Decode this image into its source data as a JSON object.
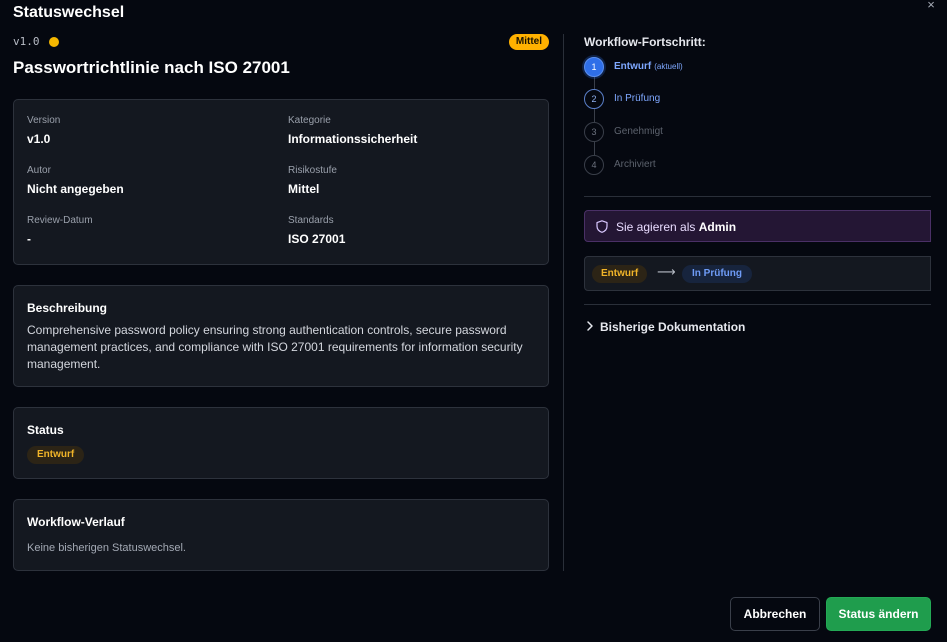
{
  "modal": {
    "title": "Statuswechsel",
    "close_icon": "close-icon",
    "close_glyph": "×"
  },
  "policy": {
    "version_tag": "v1.0",
    "risk_badge": "Mittel",
    "title": "Passwortrichtlinie nach ISO 27001"
  },
  "info": {
    "version_label": "Version",
    "version_value": "v1.0",
    "category_label": "Kategorie",
    "category_value": "Informationssicherheit",
    "author_label": "Autor",
    "author_value": "Nicht angegeben",
    "risk_label": "Risikostufe",
    "risk_value": "Mittel",
    "review_label": "Review-Datum",
    "review_value": "-",
    "standards_label": "Standards",
    "standards_value": "ISO 27001"
  },
  "description": {
    "heading": "Beschreibung",
    "text": "Comprehensive password policy ensuring strong authentication controls, secure password management practices, and compliance with ISO 27001 requirements for information security management."
  },
  "status": {
    "heading": "Status",
    "badge": "Entwurf"
  },
  "history": {
    "heading": "Workflow-Verlauf",
    "empty": "Keine bisherigen Statuswechsel."
  },
  "workflow": {
    "heading": "Workflow-Fortschritt:",
    "steps": [
      {
        "number": "1",
        "label": "Entwurf",
        "sub": "(aktuell)"
      },
      {
        "number": "2",
        "label": "In Prüfung"
      },
      {
        "number": "3",
        "label": "Genehmigt"
      },
      {
        "number": "4",
        "label": "Archiviert"
      }
    ]
  },
  "role": {
    "prefix": "Sie agieren als",
    "name": "Admin",
    "icon": "shield-icon"
  },
  "transition": {
    "from": "Entwurf",
    "arrow": "⟶",
    "to": "In Prüfung"
  },
  "prev_docs": {
    "label": "Bisherige Dokumentation",
    "icon": "chevron-right-icon"
  },
  "buttons": {
    "cancel": "Abbrechen",
    "submit": "Status ändern"
  },
  "colors": {
    "background": "#050810",
    "card": "#141820",
    "warning": "#f5b700",
    "accent_blue": "#2f6fe8",
    "role_purple": "#241634",
    "success": "#1f9d4d"
  }
}
